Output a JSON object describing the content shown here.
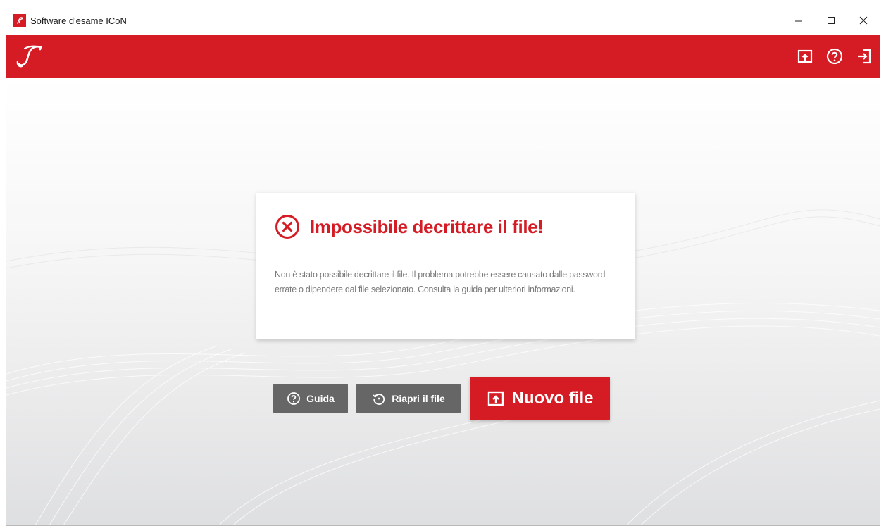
{
  "window": {
    "title": "Software d'esame ICoN",
    "controls": [
      "minimize-icon",
      "maximize-icon",
      "close-icon"
    ]
  },
  "appbar": {
    "logo_letter": "I",
    "actions": [
      {
        "name": "open-file-icon"
      },
      {
        "name": "help-icon"
      },
      {
        "name": "exit-icon"
      }
    ]
  },
  "dialog": {
    "title": "Impossibile decrittare il file!",
    "icon": "error-circle-x-icon",
    "message": "Non è stato possibile decrittare il file. Il problema potrebbe essere causato dalle password errate o dipendere dal file selezionato. Consulta la guida per ulteriori informazioni."
  },
  "buttons": {
    "guide": "Guida",
    "reopen": "Riapri il file",
    "new_file": "Nuovo file"
  },
  "colors": {
    "brand_red": "#d51b23",
    "button_gray": "#666666",
    "text_gray": "#7a7a7a"
  }
}
